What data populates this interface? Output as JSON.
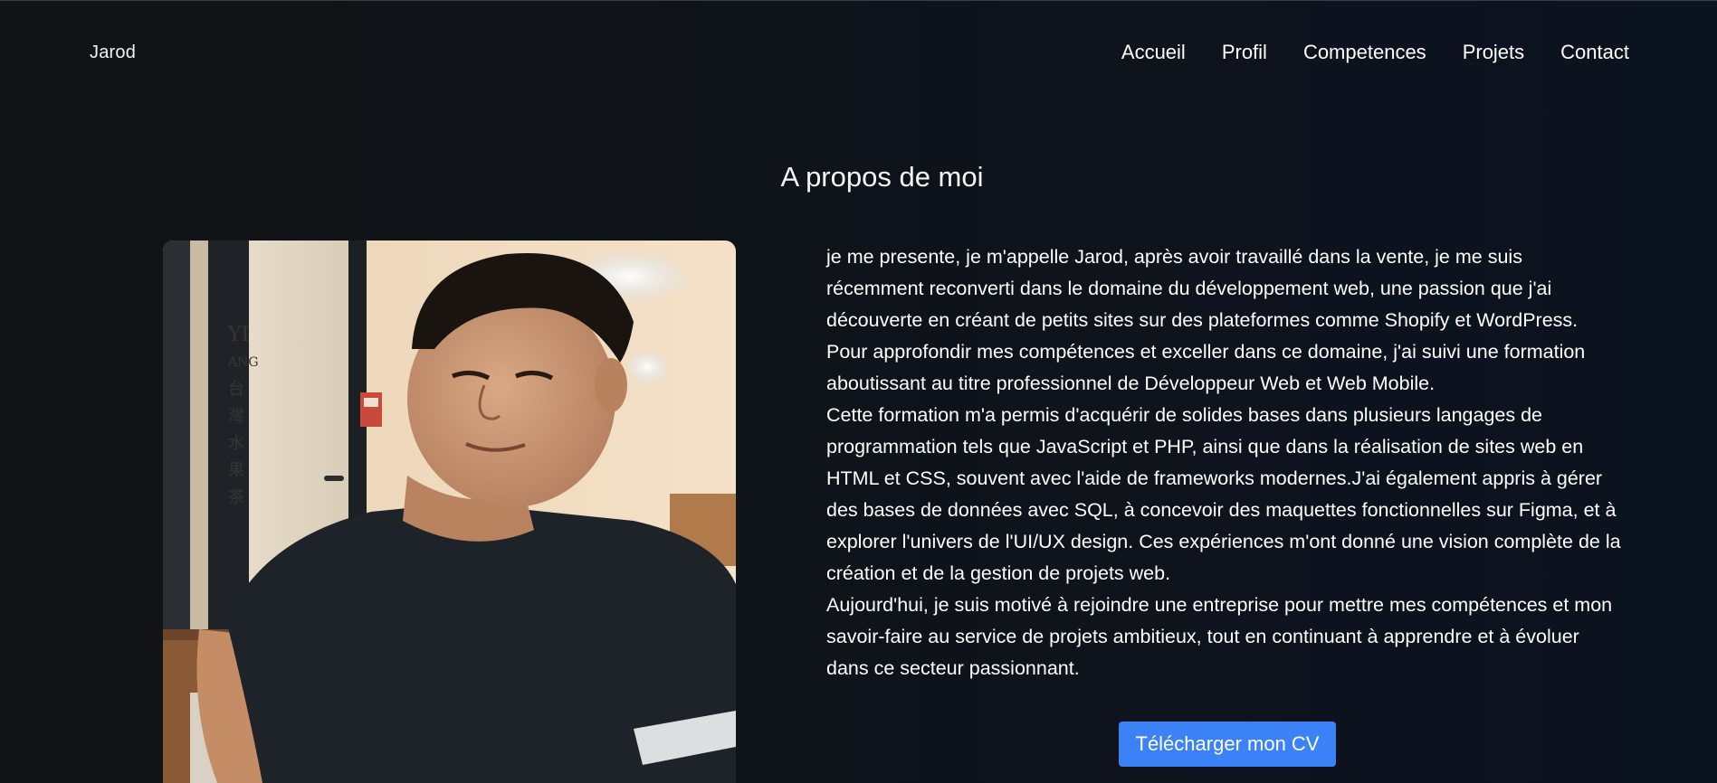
{
  "header": {
    "brand": "Jarod",
    "nav": [
      "Accueil",
      "Profil",
      "Competences",
      "Projets",
      "Contact"
    ]
  },
  "about": {
    "title": "A propos de moi",
    "photo_sign_text": [
      "YI",
      "ANG",
      "台",
      "灣",
      "水",
      "果",
      "茶"
    ],
    "paragraphs": [
      "je me presente, je m'appelle Jarod, après avoir travaillé dans la vente, je me suis récemment reconverti dans le domaine du développement web, une passion que j'ai découverte en créant de petits sites sur des plateformes comme Shopify et WordPress. Pour approfondir mes compétences et exceller dans ce domaine, j'ai suivi une formation aboutissant au titre professionnel de Développeur Web et Web Mobile.",
      "Cette formation m'a permis d'acquérir de solides bases dans plusieurs langages de programmation tels que JavaScript et PHP, ainsi que dans la réalisation de sites web en HTML et CSS, souvent avec l'aide de frameworks modernes.J'ai également appris à gérer des bases de données avec SQL, à concevoir des maquettes fonctionnelles sur Figma, et à explorer l'univers de l'UI/UX design. Ces expériences m'ont donné une vision complète de la création et de la gestion de projets web.",
      "Aujourd'hui, je suis motivé à rejoindre une entreprise pour mettre mes compétences et mon savoir-faire au service de projets ambitieux, tout en continuant à apprendre et à évoluer dans ce secteur passionnant."
    ],
    "cv_button": "Télécharger mon CV"
  },
  "colors": {
    "background": "#101318",
    "button": "#3b82f6",
    "text": "#ffffff"
  }
}
